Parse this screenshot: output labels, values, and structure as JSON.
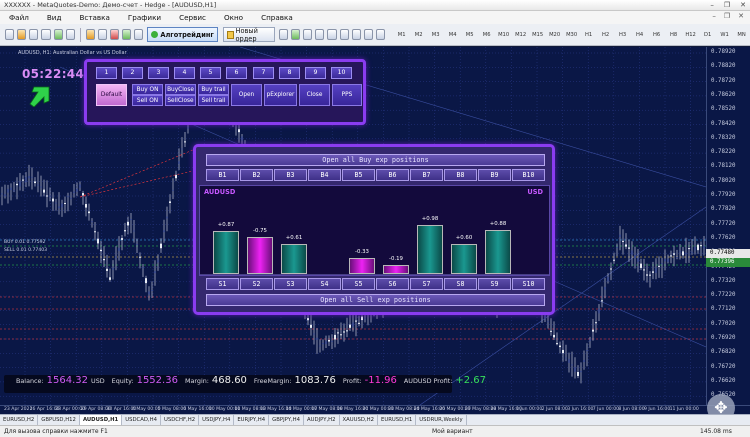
{
  "window": {
    "title": "XXXXXX - MetaQuotes-Demo: Демо-счет - Hedge - [AUDUSD,H1]",
    "controls": [
      "–",
      "❐",
      "✕"
    ]
  },
  "menu": {
    "items": [
      "Файл",
      "Вид",
      "Вставка",
      "Графики",
      "Сервис",
      "Окно",
      "Справка"
    ],
    "mdi_controls": [
      "–",
      "❐",
      "✕"
    ]
  },
  "toolbar": {
    "algo_label": "Алготрейдинг",
    "new_order_label": "Новый ордер",
    "timeframes": [
      "M1",
      "M2",
      "M3",
      "M4",
      "M5",
      "M6",
      "M10",
      "M12",
      "M15",
      "M20",
      "M30",
      "H1",
      "H2",
      "H3",
      "H4",
      "H6",
      "H8",
      "H12",
      "D1",
      "W1",
      "MN"
    ]
  },
  "chart": {
    "title": "AUDUSD, H1:  Australian Dollar vs US Dollar",
    "clock": "05:22:44",
    "colors": {
      "bg": "#0a1746",
      "grid": "#2a3a8a",
      "accent": "#8a3cf0"
    },
    "bid_tag": "0.77480",
    "ask_tag": "0.77396",
    "left_labels": [
      "BUY 0.01 0.77592",
      "SELL 0.01 0.77403"
    ]
  },
  "price_scale": [
    "0.78920",
    "0.78820",
    "0.78720",
    "0.78620",
    "0.78520",
    "0.78420",
    "0.78320",
    "0.78220",
    "0.78120",
    "0.78020",
    "0.77920",
    "0.77820",
    "0.77720",
    "0.77620",
    "0.77520",
    "0.77420",
    "0.77320",
    "0.77220",
    "0.77120",
    "0.77020",
    "0.76920",
    "0.76820",
    "0.76720",
    "0.76620",
    "0.76520"
  ],
  "time_axis": [
    "23 Apr 2021",
    "26 Apr 16:00",
    "28 Apr 00:00",
    "29 Apr 08:00",
    "30 Apr 16:00",
    "4 May 00:00",
    "5 May 08:00",
    "6 May 16:00",
    "10 May 00:00",
    "11 May 08:00",
    "12 May 16:00",
    "14 May 00:00",
    "17 May 08:00",
    "18 May 16:00",
    "20 May 00:00",
    "21 May 08:00",
    "24 May 16:00",
    "26 May 00:00",
    "27 May 08:00",
    "28 May 16:00",
    "1 Jun 00:00",
    "2 Jun 08:00",
    "3 Jun 16:00",
    "7 Jun 00:00",
    "8 Jun 08:00",
    "9 Jun 16:00",
    "11 Jun 00:00"
  ],
  "control_panel": {
    "numbers": [
      "1",
      "2",
      "3",
      "4",
      "5",
      "6",
      "7",
      "8",
      "9",
      "10"
    ],
    "default_label": "Default",
    "buy_on": "Buy ON",
    "sell_on": "Sell ON",
    "buy_close": "BuyClose",
    "sell_close": "SellClose",
    "buy_trail": "Buy trail",
    "sell_trail": "Sell trail",
    "open": "Open",
    "pexplorer": "pExplorer",
    "close": "Close",
    "pps": "PPS"
  },
  "positions_panel": {
    "open_buy_label": "Open all Buy exp positions",
    "open_sell_label": "Open all Sell exp positions",
    "buy_buttons": [
      "B1",
      "B2",
      "B3",
      "B4",
      "B5",
      "B6",
      "B7",
      "B8",
      "B9",
      "B10"
    ],
    "sell_buttons": [
      "S1",
      "S2",
      "S3",
      "S4",
      "S5",
      "S6",
      "S7",
      "S8",
      "S9",
      "S10"
    ],
    "symbol_left": "AUDUSD",
    "symbol_right": "USD",
    "profits": [
      0.87,
      -0.75,
      0.61,
      null,
      -0.33,
      -0.19,
      0.98,
      0.6,
      0.88,
      null
    ],
    "profit_labels": [
      "+0.87",
      "-0.75",
      "+0.61",
      "",
      "-0.33",
      "-0.19",
      "+0.98",
      "+0.60",
      "+0.88",
      ""
    ],
    "colors": {
      "positive": "#1a9890",
      "negative": "#ee22f4"
    }
  },
  "account": {
    "balance_label": "Balance:",
    "balance_value": "1564.32",
    "balance_cur": "USD",
    "equity_label": "Equity:",
    "equity_value": "1552.36",
    "margin_label": "Margin:",
    "margin_value": "468.60",
    "freemargin_label": "FreeMargin:",
    "freemargin_value": "1083.76",
    "profit_label": "Profit:",
    "profit_value": "-11.96",
    "symprofit_label": "AUDUSD Profit:",
    "symprofit_value": "+2.67",
    "colors": {
      "balance": "#d05cf5",
      "negative": "#ff3ad8",
      "positive": "#36e05a",
      "neutral": "#f0f0f0"
    }
  },
  "symbol_tabs": [
    "EURUSD,H2",
    "GBPUSD,H12",
    "AUDUSD,H1",
    "USDCAD,H4",
    "USDCHF,H2",
    "USDJPY,H4",
    "EURJPY,H4",
    "GBPJPY,H4",
    "AUDJPY,H2",
    "XAUUSD,H2",
    "EURUSD,H1",
    "USDRUR,Weekly"
  ],
  "active_tab": 2,
  "status": {
    "help": "Для вызова справки нажмите F1",
    "profile": "Мой вариант",
    "net": "145.08 ms"
  }
}
